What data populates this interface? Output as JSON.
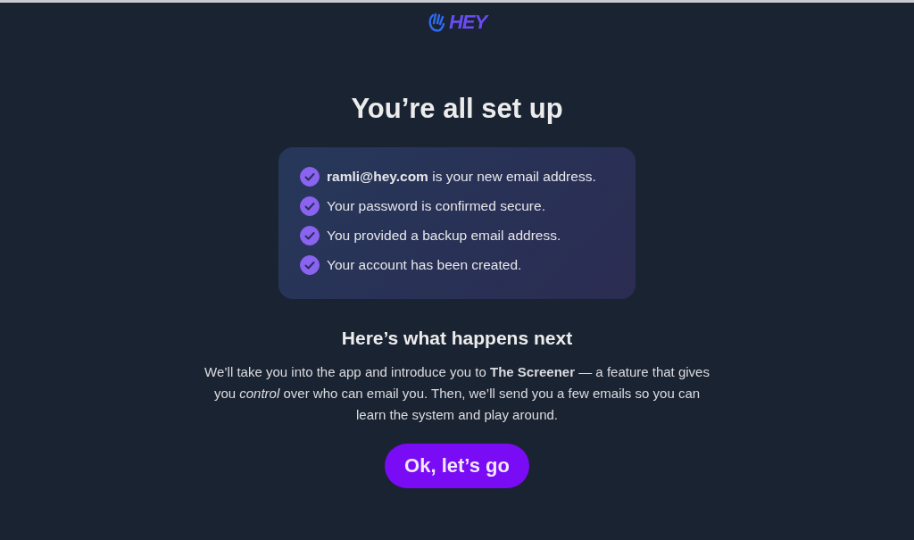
{
  "logo": {
    "text": "HEY"
  },
  "title": "You’re all set up",
  "checklist": [
    {
      "text": "**ramli@hey.com** is your new email address.",
      "checked": true
    },
    {
      "text": "Your password is confirmed secure.",
      "checked": true
    },
    {
      "text": "You provided a backup email address.",
      "checked": true
    },
    {
      "text": "Your account has been created.",
      "checked": true
    }
  ],
  "next": {
    "heading": "Here’s what happens next",
    "body": "We’ll take you into the app and introduce you to **The Screener** — a feature that gives you *control* over who can email you. Then, we’ll send you a few emails so you can learn the system and play around."
  },
  "button": "Ok, let’s go"
}
